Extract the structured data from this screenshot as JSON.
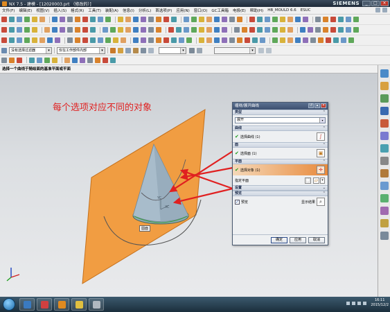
{
  "window": {
    "title": "NX 7.5 - 建模 - [12020003.prt （修改的）]",
    "brand": "SIEMENS",
    "buttons": [
      "_",
      "□",
      "×"
    ]
  },
  "menubar": [
    "文件(F)",
    "编辑(E)",
    "视图(V)",
    "插入(S)",
    "格式(R)",
    "工具(T)",
    "装配(A)",
    "信息(I)",
    "分析(L)",
    "首选项(P)",
    "应用(N)",
    "窗口(O)",
    "GC工具箱",
    "电极(E)",
    "帮助(H)",
    "HB_MOULD 6.6",
    "ESUC"
  ],
  "selection_bar": {
    "filter": "没有选择过滤器",
    "scope": "仅在工作部件内部"
  },
  "status_message": "选择一个曲线于随绘面的基准平面或平面",
  "annotation": "每个选项对应不同的对象",
  "face_label": "圆面",
  "dialog": {
    "title": "缠绕/展开曲线",
    "sections": {
      "type": {
        "header": "类型",
        "value": "展开"
      },
      "curve": {
        "header": "曲线",
        "item": "选择曲线 (1)"
      },
      "face": {
        "header": "面",
        "item": "选择面 (1)"
      },
      "plane": {
        "header": "平面",
        "item": "选择对象 (1)",
        "sub": "指定平面"
      },
      "settings": {
        "header": "设置"
      },
      "preview": {
        "header": "预览",
        "checkbox": "预览",
        "show": "显示结果"
      }
    },
    "buttons": {
      "ok": "确定",
      "apply": "应用",
      "cancel": "取消"
    }
  },
  "taskbar": {
    "time": "16:11",
    "date": "2015/12/2"
  },
  "colors": {
    "plane": "#f29a3a",
    "cone": "#9fb3c2",
    "arrow": "#e02020",
    "annotation": "#e02020"
  }
}
